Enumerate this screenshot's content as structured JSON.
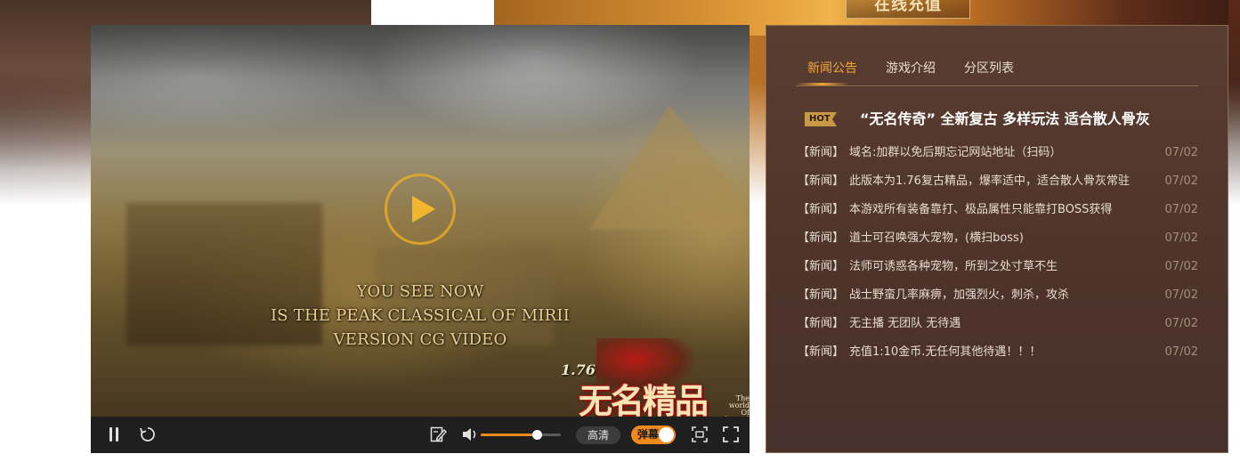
{
  "header": {
    "recharge_label": "在线充值"
  },
  "video": {
    "cg_lines": [
      "YOU SEE NOW",
      "IS THE PEAK CLASSICAL OF MIRII",
      "VERSION CG VIDEO"
    ],
    "logo": {
      "version": "1.76",
      "name": "无名精品",
      "sub_lines": [
        "The",
        "world",
        "Of",
        "legend"
      ]
    },
    "controls": {
      "quality_label": "高清",
      "danmu_label": "弹幕",
      "volume_level": 0.7
    },
    "icons": [
      "play-icon",
      "pause-icon",
      "replay-icon",
      "danmu-settings-icon",
      "volume-icon",
      "screenshot-icon",
      "fullscreen-icon"
    ]
  },
  "news": {
    "tabs": [
      {
        "label": "新闻公告",
        "active": true
      },
      {
        "label": "游戏介绍",
        "active": false
      },
      {
        "label": "分区列表",
        "active": false
      }
    ],
    "hot": {
      "badge": "HOT",
      "title": "“无名传奇” 全新复古 多样玩法 适合散人骨灰"
    },
    "items": [
      {
        "tag": "【新闻】",
        "text": "域名:加群以免后期忘记网站地址（扫码）",
        "date": "07/02"
      },
      {
        "tag": "【新闻】",
        "text": "此版本为1.76复古精品，爆率适中，适合散人骨灰常驻",
        "date": "07/02"
      },
      {
        "tag": "【新闻】",
        "text": "本游戏所有装备靠打、极品属性只能靠打BOSS获得",
        "date": "07/02"
      },
      {
        "tag": "【新闻】",
        "text": "道士可召唤强大宠物，(横扫boss)",
        "date": "07/02"
      },
      {
        "tag": "【新闻】",
        "text": "法师可诱惑各种宠物，所到之处寸草不生",
        "date": "07/02"
      },
      {
        "tag": "【新闻】",
        "text": "战士野蛮几率麻痹，加强烈火，刺杀，攻杀",
        "date": "07/02"
      },
      {
        "tag": "【新闻】",
        "text": "无主播 无团队 无待遇",
        "date": "07/02"
      },
      {
        "tag": "【新闻】",
        "text": "充值1:10金币.无任何其他待遇！！！",
        "date": "07/02"
      }
    ]
  },
  "colors": {
    "accent": "#f0a63a",
    "panel_bg": "#4d332a",
    "toggle_on": "#f08a1c"
  }
}
